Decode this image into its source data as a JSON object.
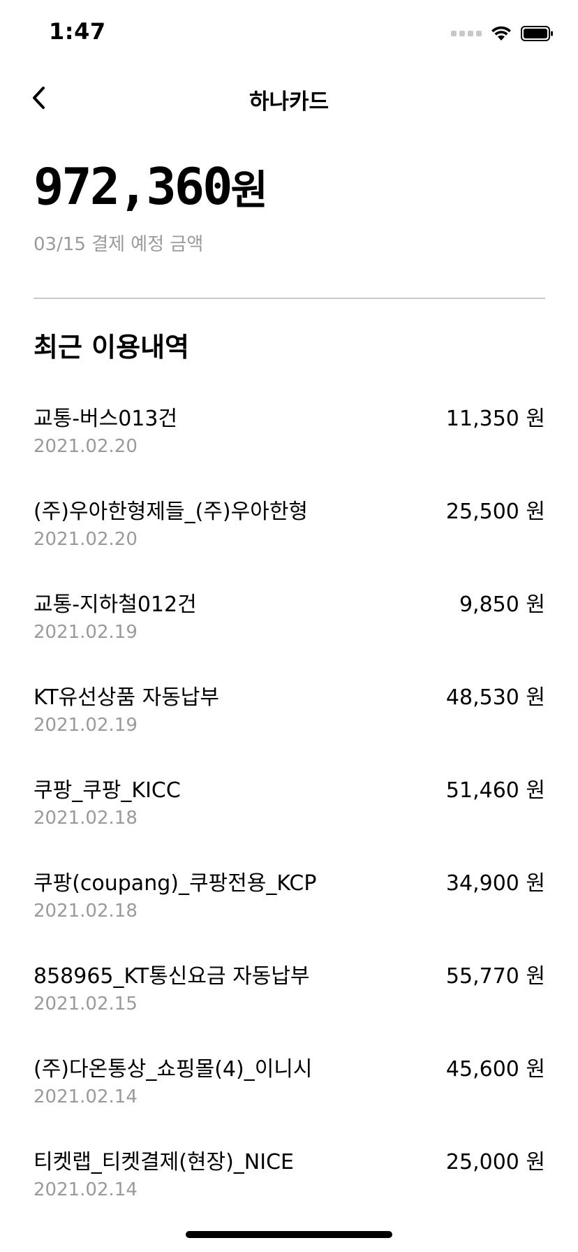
{
  "status_bar": {
    "time": "1:47"
  },
  "nav": {
    "title": "하나카드"
  },
  "summary": {
    "amount": "972,360",
    "unit": "원",
    "caption": "03/15 결제 예정 금액"
  },
  "recent": {
    "title": "최근 이용내역",
    "items": [
      {
        "name": "교통-버스013건",
        "date": "2021.02.20",
        "amount": "11,350 원"
      },
      {
        "name": "(주)우아한형제들_(주)우아한형",
        "date": "2021.02.20",
        "amount": "25,500 원"
      },
      {
        "name": "교통-지하철012건",
        "date": "2021.02.19",
        "amount": "9,850 원"
      },
      {
        "name": "KT유선상품 자동납부",
        "date": "2021.02.19",
        "amount": "48,530 원"
      },
      {
        "name": "쿠팡_쿠팡_KICC",
        "date": "2021.02.18",
        "amount": "51,460 원"
      },
      {
        "name": "쿠팡(coupang)_쿠팡전용_KCP",
        "date": "2021.02.18",
        "amount": "34,900 원"
      },
      {
        "name": "858965_KT통신요금 자동납부",
        "date": "2021.02.15",
        "amount": "55,770 원"
      },
      {
        "name": "(주)다온통상_쇼핑몰(4)_이니시",
        "date": "2021.02.14",
        "amount": "45,600 원"
      },
      {
        "name": "티켓랩_티켓결제(현장)_NICE",
        "date": "2021.02.14",
        "amount": "25,000 원"
      }
    ]
  },
  "icons": {
    "back": "chevron-left-icon",
    "signal": "signal-icon",
    "wifi": "wifi-icon",
    "battery": "battery-icon"
  }
}
